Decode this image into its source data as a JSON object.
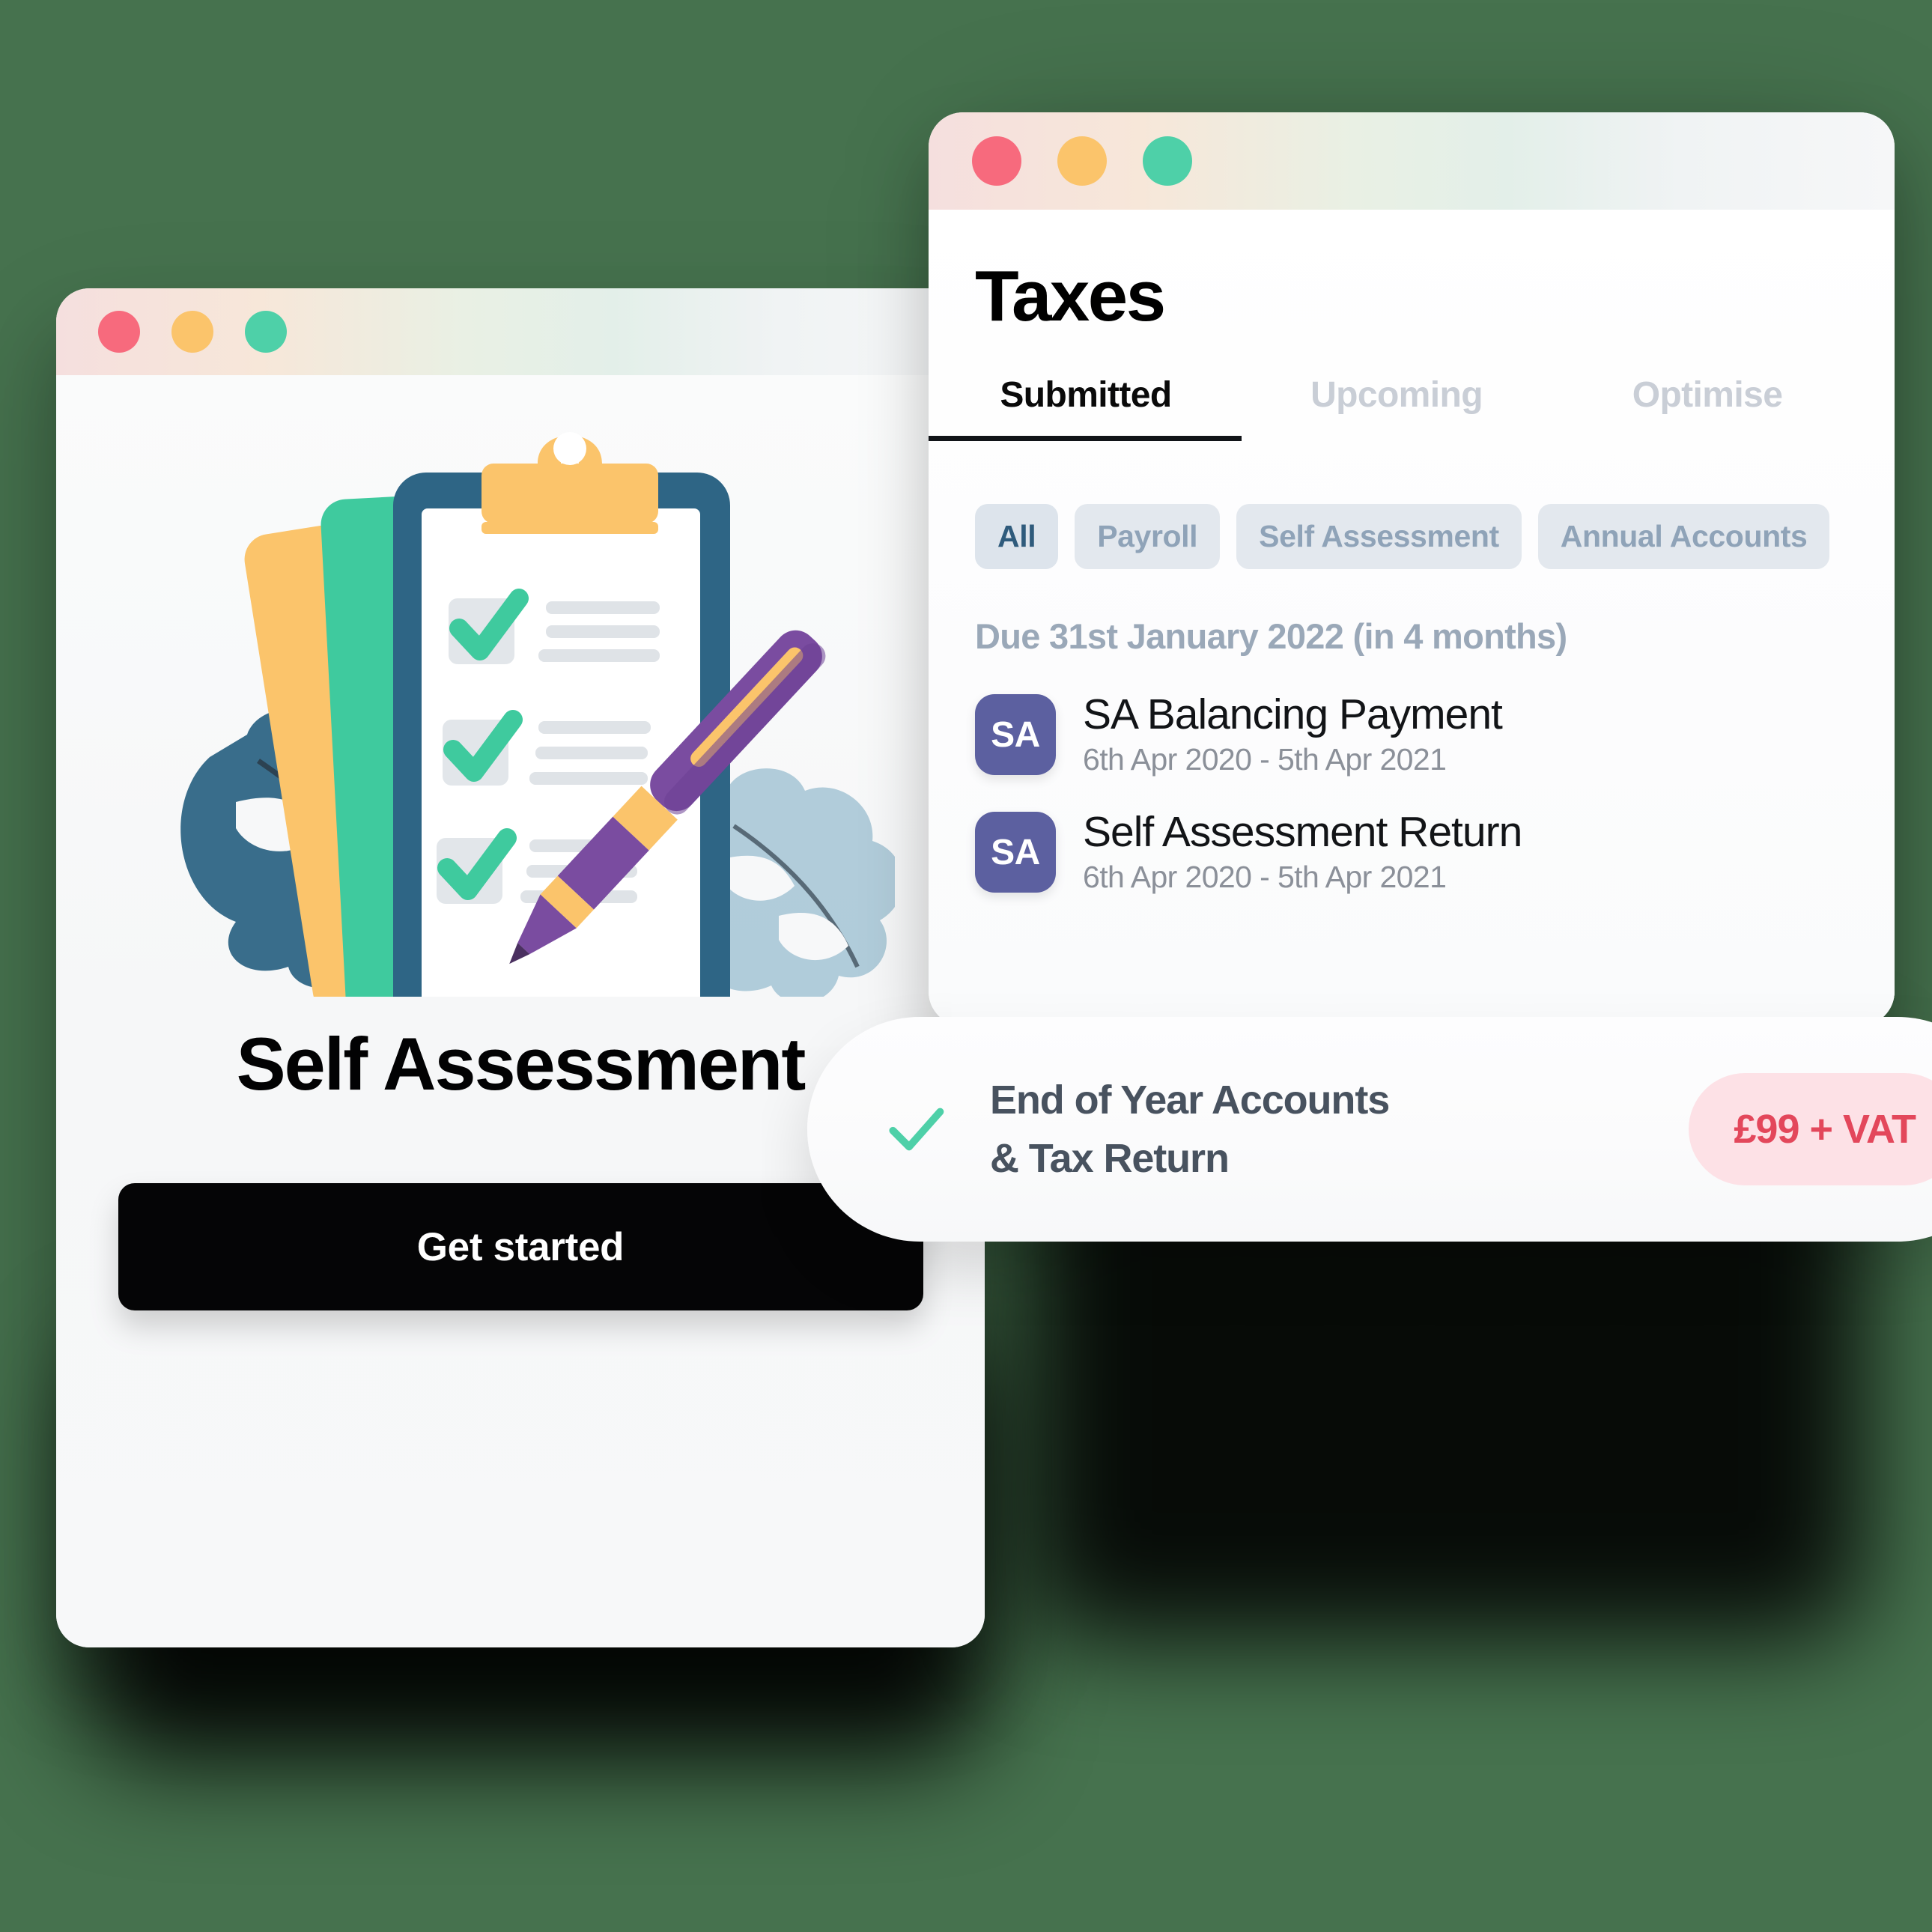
{
  "background": {
    "color": "#46724e"
  },
  "left_window": {
    "traffic_lights": [
      "close",
      "minimize",
      "maximize"
    ],
    "illustration_name": "clipboard-checklist-illustration",
    "title": "Self Assessment",
    "cta_label": "Get started"
  },
  "taxes_window": {
    "traffic_lights": [
      "close",
      "minimize",
      "maximize"
    ],
    "title": "Taxes",
    "tabs": [
      {
        "label": "Submitted",
        "active": true
      },
      {
        "label": "Upcoming",
        "active": false
      },
      {
        "label": "Optimise",
        "active": false
      }
    ],
    "filters": [
      {
        "label": "All",
        "active": true
      },
      {
        "label": "Payroll",
        "active": false
      },
      {
        "label": "Self Assessment",
        "active": false
      },
      {
        "label": "Annual Accounts",
        "active": false
      }
    ],
    "due_heading": "Due 31st January 2022 (in 4 months)",
    "items": [
      {
        "badge": "SA",
        "name": "SA Balancing Payment",
        "period": "6th Apr 2020 - 5th Apr 2021"
      },
      {
        "badge": "SA",
        "name": "Self Assessment Return",
        "period": "6th Apr 2020 - 5th Apr 2021"
      }
    ]
  },
  "eoy_card": {
    "check_icon": "check-icon",
    "line1": "End of Year Accounts",
    "line2": "& Tax Return",
    "price": "£99 + VAT"
  },
  "colors": {
    "backdrop_green": "#46724e",
    "traffic_red": "#f76a7d",
    "traffic_yellow": "#fbc46b",
    "traffic_green": "#4ed0a8",
    "badge_purple": "#5c60a0",
    "price_text": "#e3475b",
    "price_bg": "#fde1e6",
    "accent_check": "#4ed0a8",
    "cta_black": "#050506"
  }
}
